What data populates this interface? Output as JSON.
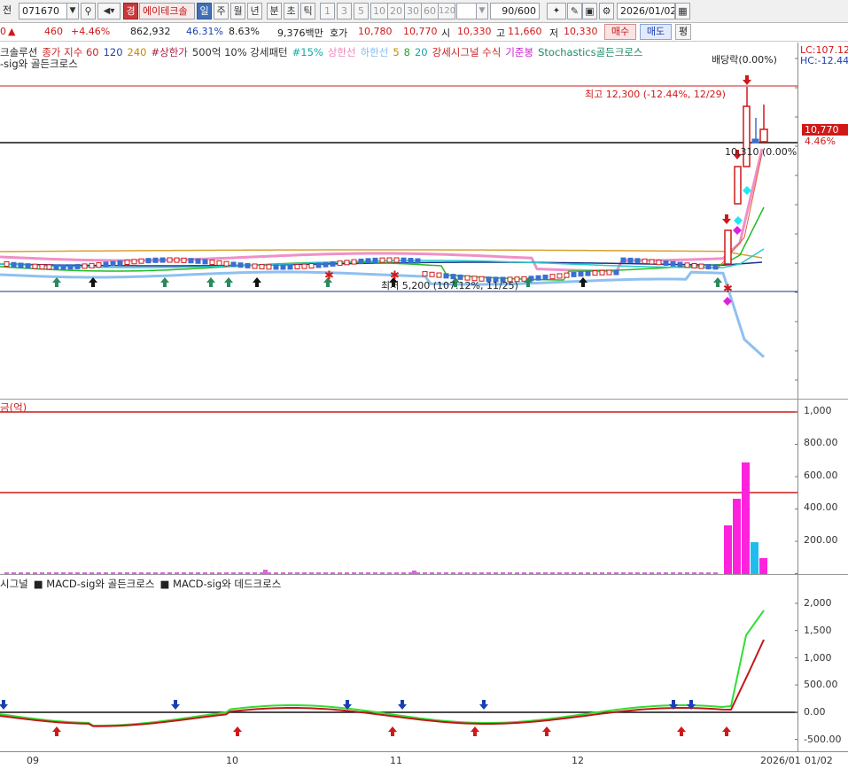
{
  "toolbar": {
    "prefix": "전",
    "code": "071670",
    "market_badge": "경",
    "stock_name": "에이테크솔",
    "periods": [
      "일",
      "주",
      "월",
      "년",
      "분",
      "초",
      "틱"
    ],
    "selected_period": "일",
    "minute_options": [
      "1",
      "3",
      "5",
      "10",
      "20",
      "30",
      "60",
      "120"
    ],
    "count": "90/600",
    "date": "2026/01/02"
  },
  "quote": {
    "change_prefix": "0",
    "change_arrow": "▲",
    "change": "460",
    "change_pct": "+4.46%",
    "volume": "862,932",
    "vol_ratio": "46.31%",
    "turnover": "8.63%",
    "amount": "9,376백만",
    "ask_label": "호가",
    "ask": "10,780",
    "bid": "10,770",
    "open_label": "시",
    "open": "10,330",
    "high_label": "고",
    "high": "11,660",
    "low_label": "저",
    "low": "10,330",
    "buy_label": "매수",
    "sell_label": "매도",
    "flat_label": "평"
  },
  "price_panel": {
    "legend_items": [
      {
        "text": "크솔루션",
        "color": "#333333"
      },
      {
        "text": "종가 지수 60",
        "color": "#cc2222"
      },
      {
        "text": "120",
        "color": "#2244aa"
      },
      {
        "text": "240",
        "color": "#cc8800"
      },
      {
        "text": "#상한가",
        "color": "#aa2244"
      },
      {
        "text": "500억 10% 강세패턴",
        "color": "#333333"
      },
      {
        "text": "#15%",
        "color": "#11aaaa"
      },
      {
        "text": "상한선",
        "color": "#ee88bb"
      },
      {
        "text": "하한선",
        "color": "#88bbee"
      },
      {
        "text": "5",
        "color": "#cc8800"
      },
      {
        "text": "8",
        "color": "#22aa22"
      },
      {
        "text": "20",
        "color": "#11aaaa"
      },
      {
        "text": "강세시그널 수식",
        "color": "#cc2222"
      },
      {
        "text": "기준봉",
        "color": "#cc22cc"
      },
      {
        "text": "Stochastics골든크로스",
        "color": "#228866"
      }
    ],
    "legend_line2": "-sig와 골든크로스",
    "lc_label": "LC:107.12",
    "hc_label": "HC:-12.44",
    "dividend_label": "배당락(0.00%)",
    "high_annotation": "최고 12,300 (-12.44%, 12/29)",
    "low_annotation": "최저 5,200 (107.12%, 11/25)",
    "ref_annotation": "10,310 (0.00%)",
    "price_tag": "10,770",
    "price_tag_pct": "4.46%"
  },
  "amount_panel": {
    "title": "금(억)",
    "ticks": [
      "1,000",
      "800.00",
      "600.00",
      "400.00",
      "200.00"
    ]
  },
  "macd_panel": {
    "legend": [
      {
        "text": "시그널",
        "color": "#cc2222"
      },
      {
        "text": "MACD-sig와 골든크로스",
        "color": "#cc2222"
      },
      {
        "text": "MACD-sig와 데드크로스",
        "color": "#2244aa"
      }
    ],
    "ticks": [
      "2,000",
      "1,500",
      "1,000",
      "500.00",
      "0.00",
      "-500.00"
    ]
  },
  "date_axis": {
    "labels": [
      "09",
      "10",
      "11",
      "12",
      "2026/01",
      "01/02"
    ]
  }
}
